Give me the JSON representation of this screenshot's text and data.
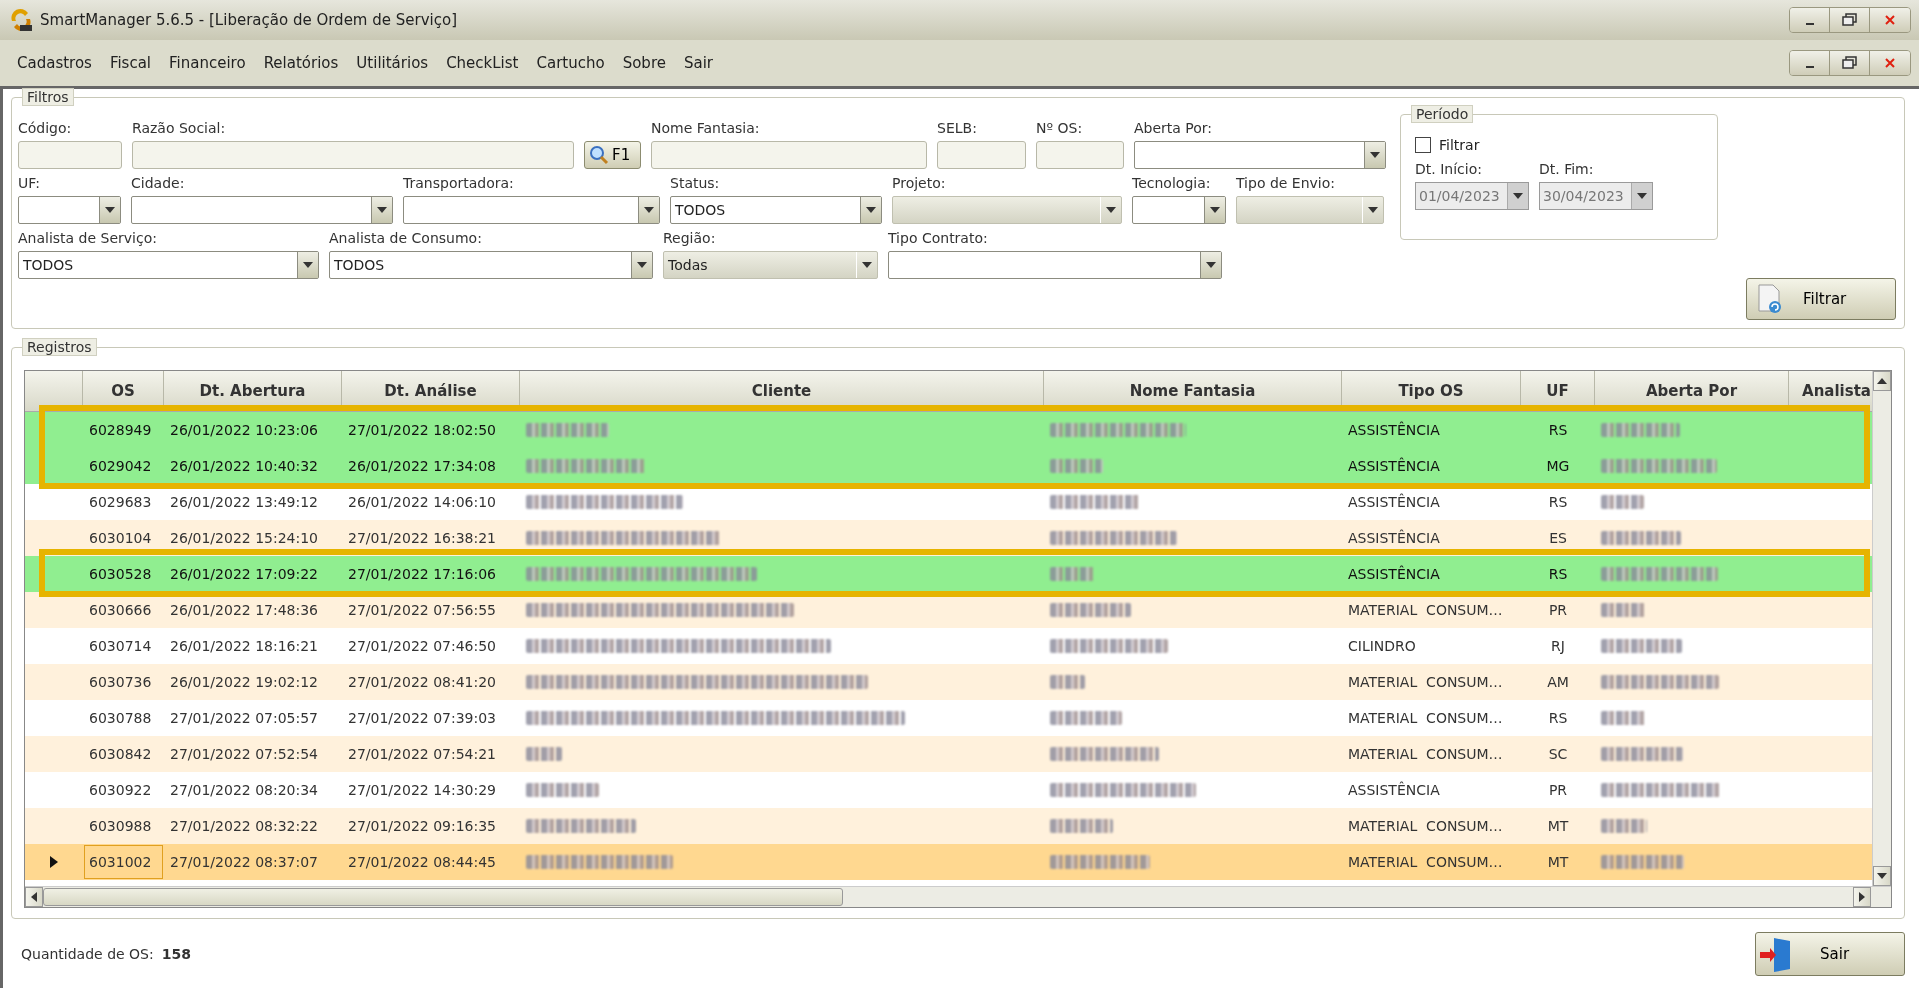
{
  "window": {
    "title": "SmartManager 5.6.5 - [Liberação de Ordem de Serviço]"
  },
  "menu": [
    "Cadastros",
    "Fiscal",
    "Financeiro",
    "Relatórios",
    "Utilitários",
    "CheckList",
    "Cartucho",
    "Sobre",
    "Sair"
  ],
  "filters": {
    "title": "Filtros",
    "fields": [
      {
        "kind": "text",
        "label": "Código:"
      },
      {
        "kind": "text",
        "label": "Razão Social:"
      },
      {
        "kind": "button",
        "text": "F1"
      },
      {
        "kind": "text",
        "label": "Nome Fantasia:"
      },
      {
        "kind": "text",
        "label": "SELB:"
      },
      {
        "kind": "text",
        "label": "Nº OS:"
      },
      {
        "kind": "combo",
        "label": "Aberta Por:",
        "disabled": false
      },
      {
        "kind": "combo",
        "label": "UF:",
        "disabled": false
      },
      {
        "kind": "combo",
        "label": "Cidade:",
        "disabled": false
      },
      {
        "kind": "combo",
        "label": "Transportadora:",
        "disabled": false
      },
      {
        "kind": "combo",
        "label": "Status:",
        "value": "TODOS",
        "disabled": false
      },
      {
        "kind": "combo",
        "label": "Projeto:",
        "disabled": true
      },
      {
        "kind": "combo",
        "label": "Tecnologia:",
        "disabled": false
      },
      {
        "kind": "combo",
        "label": "Tipo de Envio:",
        "disabled": true
      },
      {
        "kind": "combo",
        "label": "Analista de Serviço:",
        "value": "TODOS",
        "disabled": false
      },
      {
        "kind": "combo",
        "label": "Analista de Consumo:",
        "value": "TODOS",
        "disabled": false
      },
      {
        "kind": "combo",
        "label": "Região:",
        "value": "Todas",
        "disabled": true
      },
      {
        "kind": "combo",
        "label": "Tipo Contrato:",
        "disabled": false
      }
    ]
  },
  "period": {
    "title": "Período",
    "checkbox": {
      "label": "Filtrar",
      "checked": false
    },
    "start": {
      "label": "Dt. Início:",
      "value": "01/04/2023",
      "disabled": true
    },
    "end": {
      "label": "Dt. Fim:",
      "value": "30/04/2023",
      "disabled": true
    }
  },
  "filter_button": "Filtrar",
  "records": {
    "title": "Registros",
    "columns": [
      "OS",
      "Dt. Abertura",
      "Dt. Análise",
      "Cliente",
      "Nome Fantasia",
      "Tipo OS",
      "UF",
      "Aberta Por",
      "Analista"
    ],
    "rows": [
      {
        "os": "6028949",
        "opened": "26/01/2022 10:23:06",
        "analyzed": "27/01/2022 18:02:50",
        "type": "ASSISTÊNCIA",
        "uf": "RS",
        "highlighted": true,
        "annotated": true,
        "selected": false
      },
      {
        "os": "6029042",
        "opened": "26/01/2022 10:40:32",
        "analyzed": "26/01/2022 17:34:08",
        "type": "ASSISTÊNCIA",
        "uf": "MG",
        "highlighted": true,
        "annotated": true,
        "selected": false
      },
      {
        "os": "6029683",
        "opened": "26/01/2022 13:49:12",
        "analyzed": "26/01/2022 14:06:10",
        "type": "ASSISTÊNCIA",
        "uf": "RS",
        "highlighted": false,
        "annotated": false,
        "selected": false
      },
      {
        "os": "6030104",
        "opened": "26/01/2022 15:24:10",
        "analyzed": "27/01/2022 16:38:21",
        "type": "ASSISTÊNCIA",
        "uf": "ES",
        "highlighted": false,
        "annotated": false,
        "selected": false
      },
      {
        "os": "6030528",
        "opened": "26/01/2022 17:09:22",
        "analyzed": "27/01/2022 17:16:06",
        "type": "ASSISTÊNCIA",
        "uf": "RS",
        "highlighted": true,
        "annotated": true,
        "selected": false
      },
      {
        "os": "6030666",
        "opened": "26/01/2022 17:48:36",
        "analyzed": "27/01/2022 07:56:55",
        "type": "MATERIAL  CONSUM…",
        "uf": "PR",
        "highlighted": false,
        "annotated": false,
        "selected": false
      },
      {
        "os": "6030714",
        "opened": "26/01/2022 18:16:21",
        "analyzed": "27/01/2022 07:46:50",
        "type": "CILINDRO",
        "uf": "RJ",
        "highlighted": false,
        "annotated": false,
        "selected": false
      },
      {
        "os": "6030736",
        "opened": "26/01/2022 19:02:12",
        "analyzed": "27/01/2022 08:41:20",
        "type": "MATERIAL  CONSUM…",
        "uf": "AM",
        "highlighted": false,
        "annotated": false,
        "selected": false
      },
      {
        "os": "6030788",
        "opened": "27/01/2022 07:05:57",
        "analyzed": "27/01/2022 07:39:03",
        "type": "MATERIAL  CONSUM…",
        "uf": "RS",
        "highlighted": false,
        "annotated": false,
        "selected": false
      },
      {
        "os": "6030842",
        "opened": "27/01/2022 07:52:54",
        "analyzed": "27/01/2022 07:54:21",
        "type": "MATERIAL  CONSUM…",
        "uf": "SC",
        "highlighted": false,
        "annotated": false,
        "selected": false
      },
      {
        "os": "6030922",
        "opened": "27/01/2022 08:20:34",
        "analyzed": "27/01/2022 14:30:29",
        "type": "ASSISTÊNCIA",
        "uf": "PR",
        "highlighted": false,
        "annotated": false,
        "selected": false
      },
      {
        "os": "6030988",
        "opened": "27/01/2022 08:32:22",
        "analyzed": "27/01/2022 09:16:35",
        "type": "MATERIAL  CONSUM…",
        "uf": "MT",
        "highlighted": false,
        "annotated": false,
        "selected": false
      },
      {
        "os": "6031002",
        "opened": "27/01/2022 08:37:07",
        "analyzed": "27/01/2022 08:44:45",
        "type": "MATERIAL  CONSUM…",
        "uf": "MT",
        "highlighted": false,
        "annotated": false,
        "selected": true
      }
    ]
  },
  "footer": {
    "count_label": "Quantidade de OS:",
    "count": "158",
    "exit_button": "Sair"
  }
}
